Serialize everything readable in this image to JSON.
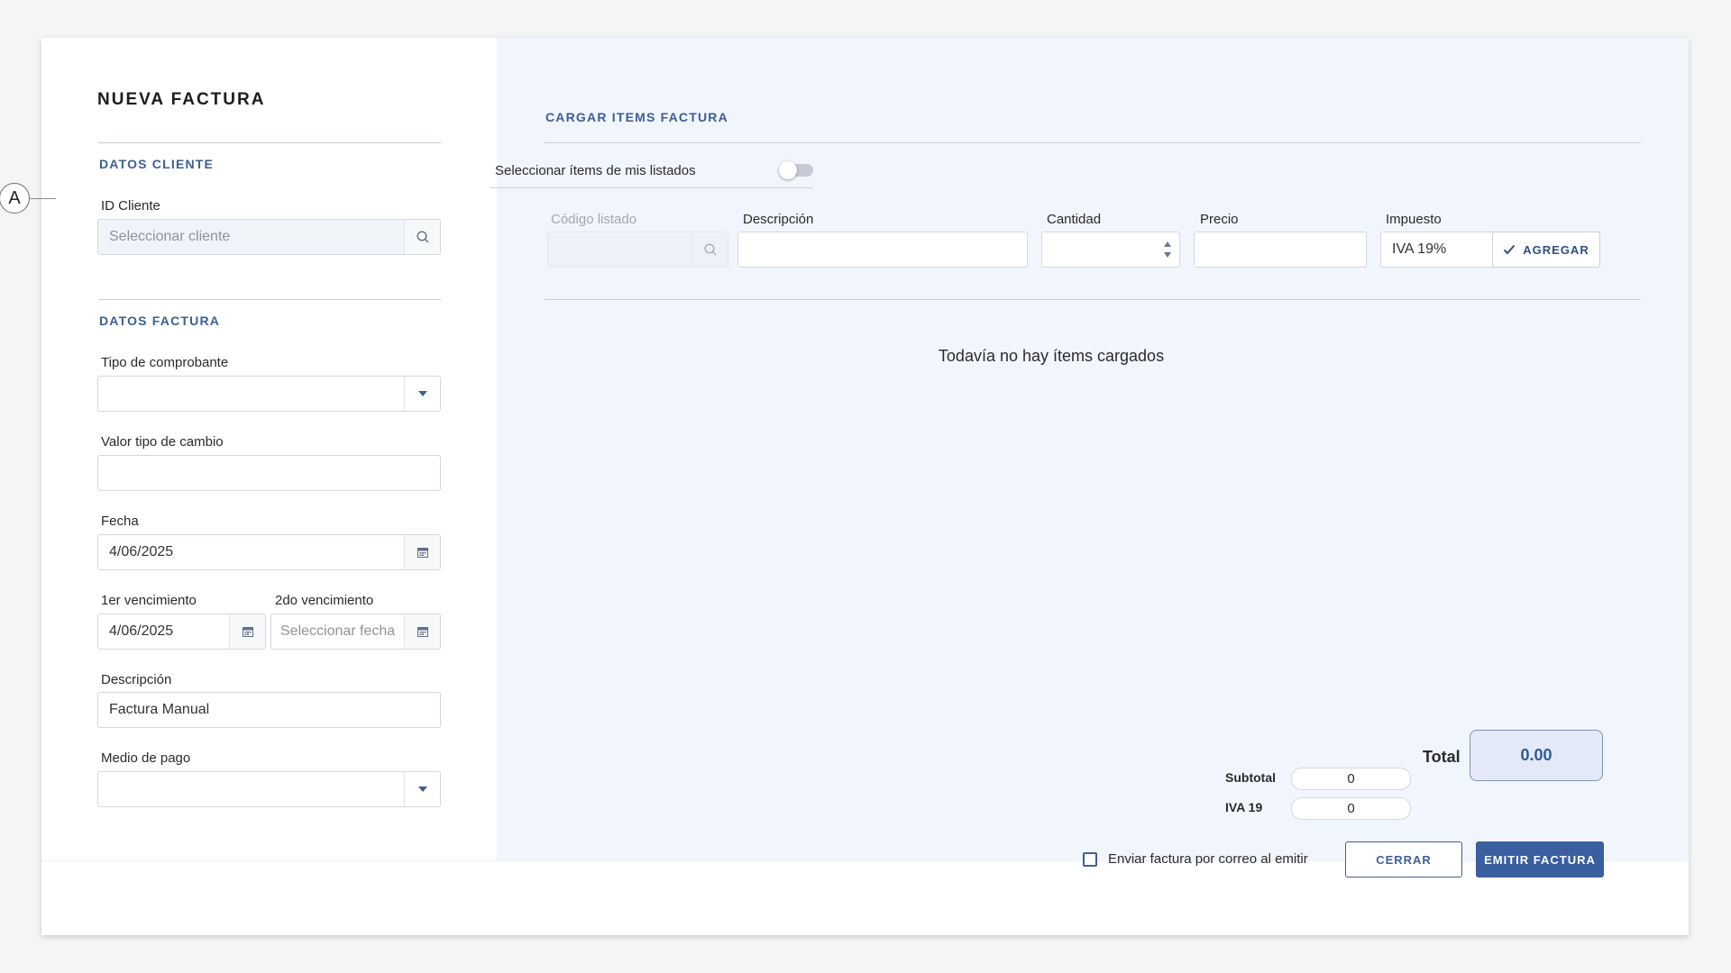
{
  "title": "NUEVA FACTURA",
  "marker": "A",
  "cliente": {
    "section": "DATOS CLIENTE",
    "id_label": "ID Cliente",
    "id_placeholder": "Seleccionar cliente"
  },
  "factura": {
    "section": "DATOS FACTURA",
    "tipo_comprobante_label": "Tipo de comprobante",
    "tipo_comprobante_value": "",
    "tipo_cambio_label": "Valor tipo de cambio",
    "tipo_cambio_value": "",
    "fecha_label": "Fecha",
    "fecha_value": "4/06/2025",
    "venc1_label": "1er vencimiento",
    "venc1_value": "4/06/2025",
    "venc2_label": "2do vencimiento",
    "venc2_placeholder": "Seleccionar fecha",
    "descripcion_label": "Descripción",
    "descripcion_value": "Factura Manual",
    "medio_pago_label": "Medio de pago",
    "medio_pago_value": ""
  },
  "items": {
    "section": "CARGAR ITEMS FACTURA",
    "toggle_label": "Seleccionar ítems de mis listados",
    "toggle_on": false,
    "codigo_label": "Código listado",
    "descripcion_label": "Descripción",
    "cantidad_label": "Cantidad",
    "precio_label": "Precio",
    "impuesto_label": "Impuesto",
    "impuesto_value": "IVA 19%",
    "agregar_label": "AGREGAR",
    "empty_message": "Todavía no hay ítems cargados"
  },
  "totals": {
    "subtotal_label": "Subtotal",
    "subtotal_value": "0",
    "iva_label": "IVA 19",
    "iva_value": "0",
    "total_label": "Total",
    "total_value": "0.00"
  },
  "footer": {
    "email_checkbox_label": "Enviar factura por correo al emitir",
    "email_checked": false,
    "cerrar_label": "CERRAR",
    "emitir_label": "EMITIR FACTURA"
  },
  "colors": {
    "accent": "#3a5fa0",
    "section_label": "#3b5f94",
    "right_panel_bg": "#f1f5fc"
  }
}
